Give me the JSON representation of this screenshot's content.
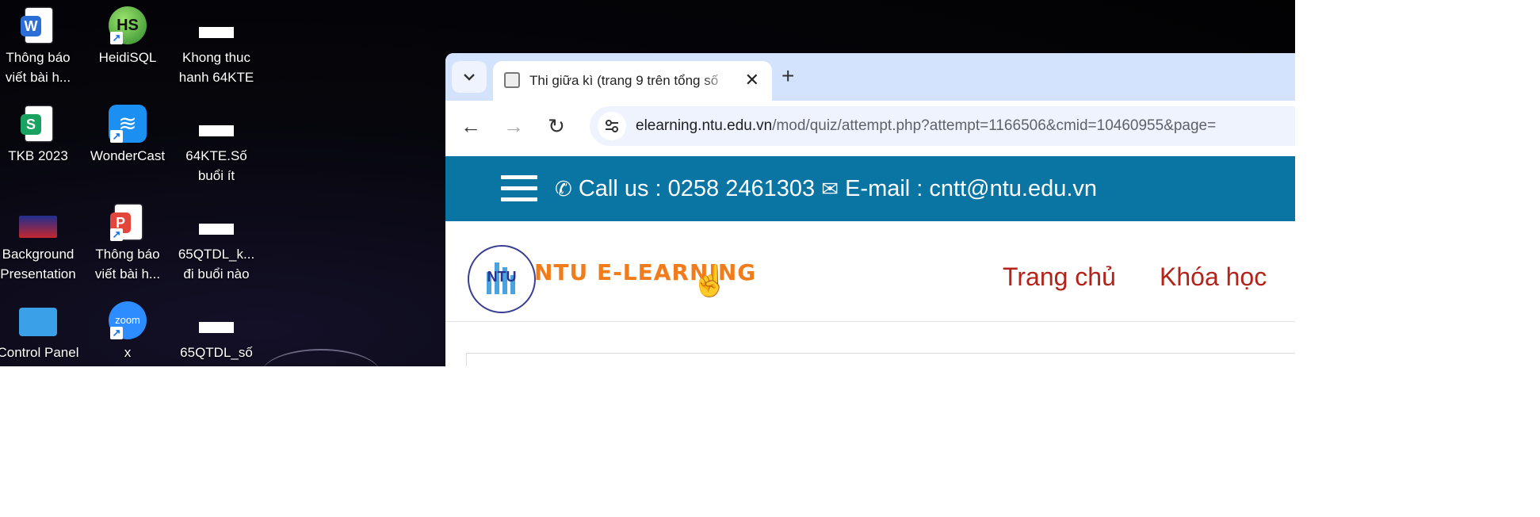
{
  "desktop": {
    "icons": [
      {
        "label": "Thông báo\nviết bài h...",
        "icon": "word-doc-icon"
      },
      {
        "label": "HeidiSQL",
        "icon": "heidisql-icon"
      },
      {
        "label": "Khong thuc\nhanh 64KTE",
        "icon": "file-icon"
      },
      {
        "label": "TKB 2023",
        "icon": "spreadsheet-icon"
      },
      {
        "label": "WonderCast",
        "icon": "wondercast-icon"
      },
      {
        "label": "64KTE.Số\nbuổi ít",
        "icon": "file-icon"
      },
      {
        "label": "Background\nPresentation",
        "icon": "presentation-icon"
      },
      {
        "label": "Thông báo\nviết bài h...",
        "icon": "pdf-icon"
      },
      {
        "label": "65QTDL_k...\nđi buổi nào",
        "icon": "file-icon"
      },
      {
        "label": "Control Panel",
        "icon": "control-panel-icon"
      },
      {
        "label": "x",
        "icon": "zoom-icon"
      },
      {
        "label": "65QTDL_số",
        "icon": "file-icon"
      }
    ]
  },
  "browser": {
    "tab_title": "Thi giữa kì (trang 9 trên tổng số",
    "url_host": "elearning.ntu.edu.vn",
    "url_path": "/mod/quiz/attempt.php?attempt=1166506&cmid=10460955&page="
  },
  "page": {
    "call_us": "Call us : 0258 2461303",
    "email": "E-mail : cntt@ntu.edu.vn",
    "logo_abbr": "NTU",
    "logo_text": "NTU E-LEARNING",
    "nav": [
      "Trang chủ",
      "Khóa học"
    ]
  },
  "colors": {
    "topbar": "#0a74a3",
    "nav_link": "#b3231a",
    "logo_orange": "#f07c1b",
    "tabstrip": "#d3e3fd"
  }
}
